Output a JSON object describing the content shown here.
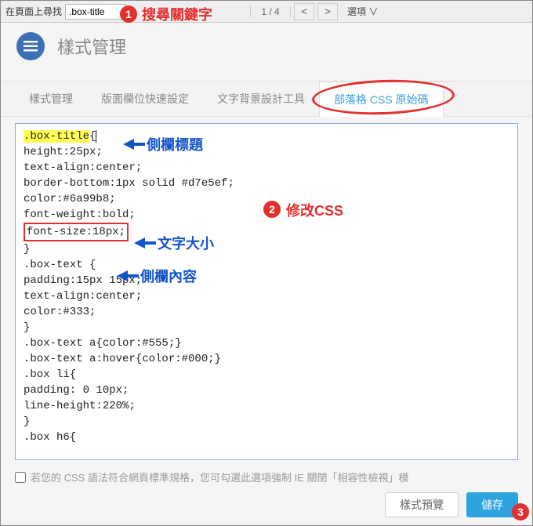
{
  "findbar": {
    "label": "在頁面上尋找",
    "input_value": ".box-title",
    "count": "1 / 4",
    "prev": "<",
    "next": ">",
    "options": "選項 ∨"
  },
  "header": {
    "title": "樣式管理"
  },
  "tabs": {
    "items": [
      {
        "label": "樣式管理"
      },
      {
        "label": "版面欄位快速設定"
      },
      {
        "label": "文字背景設計工具"
      },
      {
        "label": "部落格 CSS 原始碼"
      }
    ],
    "active_index": 3
  },
  "editor": {
    "highlight": ".box-title",
    "line1_rest": "{",
    "line2": "height:25px;",
    "line3": "text-align:center;",
    "line4": "border-bottom:1px solid #d7e5ef;",
    "line5": "color:#6a99b8;",
    "line6": "font-weight:bold;",
    "line7_boxed": "font-size:18px;",
    "line8": "}",
    "line9": ".box-text {",
    "line10": "padding:15px 15px;",
    "line11": "text-align:center;",
    "line12": "color:#333;",
    "line13": "}",
    "line14": ".box-text a{color:#555;}",
    "line15": ".box-text a:hover{color:#000;}",
    "line16": ".box li{",
    "line17": "padding: 0 10px;",
    "line18": "line-height:220%;",
    "line19": "}",
    "line20": ".box h6{"
  },
  "annotations": {
    "badge1": "1",
    "badge2": "2",
    "badge3": "3",
    "ann1": "搜尋關鍵字",
    "ann2": "修改CSS",
    "blue1": "側欄標題",
    "blue2": "文字大小",
    "blue3": "側欄內容"
  },
  "footer": {
    "compat_text": "若您的 CSS 語法符合網頁標準規格，您可勾選此選項強制 IE 關閉「相容性檢視」模",
    "preview": "樣式預覽",
    "save": "儲存"
  }
}
